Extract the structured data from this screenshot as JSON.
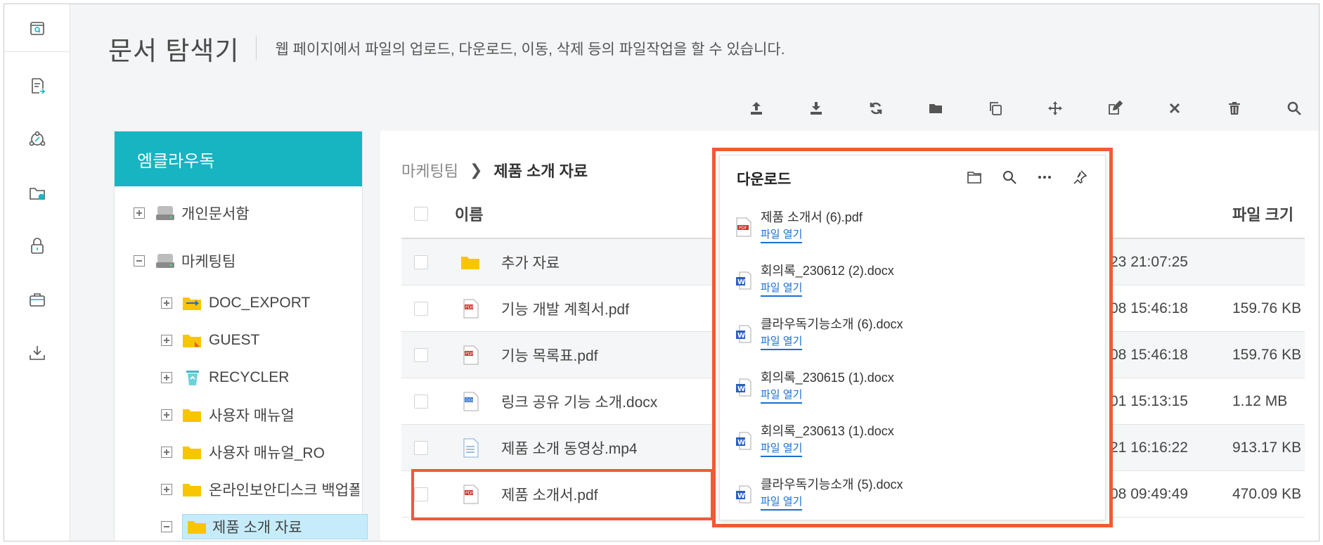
{
  "header": {
    "title": "문서 탐색기",
    "description": "웹 페이지에서 파일의 업로드, 다운로드, 이동, 삭제 등의 파일작업을 할 수 있습니다."
  },
  "rail": [
    {
      "name": "document-search-icon"
    },
    {
      "name": "document-export-icon"
    },
    {
      "name": "share-link-icon"
    },
    {
      "name": "folder-settings-icon"
    },
    {
      "name": "lock-icon"
    },
    {
      "name": "briefcase-icon"
    },
    {
      "name": "download-tray-icon"
    }
  ],
  "toolbar": [
    {
      "name": "upload-icon"
    },
    {
      "name": "download-icon"
    },
    {
      "name": "refresh-icon"
    },
    {
      "name": "new-folder-icon"
    },
    {
      "name": "copy-icon"
    },
    {
      "name": "move-icon"
    },
    {
      "name": "rename-icon"
    },
    {
      "name": "close-icon"
    },
    {
      "name": "trash-icon"
    },
    {
      "name": "search-icon"
    }
  ],
  "tree": {
    "header": "엠클라우독",
    "items": [
      {
        "label": "개인문서함",
        "toggle": "plus",
        "icon": "drive"
      },
      {
        "label": "마케팅팀",
        "toggle": "minus",
        "icon": "drive"
      },
      {
        "label": "DOC_EXPORT",
        "toggle": "plus",
        "icon": "folder-export"
      },
      {
        "label": "GUEST",
        "toggle": "plus",
        "icon": "folder-guest"
      },
      {
        "label": "RECYCLER",
        "toggle": "plus",
        "icon": "recycle"
      },
      {
        "label": "사용자 매뉴얼",
        "toggle": "plus",
        "icon": "folder"
      },
      {
        "label": "사용자 매뉴얼_RO",
        "toggle": "plus",
        "icon": "folder"
      },
      {
        "label": "온라인보안디스크 백업폴",
        "toggle": "plus",
        "icon": "folder"
      },
      {
        "label": "제품 소개 자료",
        "toggle": "minus",
        "icon": "folder",
        "selected": true
      }
    ]
  },
  "breadcrumb": {
    "parent": "마케팅팀",
    "current": "제품 소개 자료"
  },
  "table": {
    "col_name": "이름",
    "col_size": "파일 크기",
    "rows": [
      {
        "icon": "folder",
        "name": "추가 자료",
        "date": "23 21:07:25",
        "size": ""
      },
      {
        "icon": "pdf",
        "name": "기능 개발 계획서.pdf",
        "date": "08 15:46:18",
        "size": "159.76 KB"
      },
      {
        "icon": "pdf",
        "name": "기능 목록표.pdf",
        "date": "08 15:46:18",
        "size": "159.76 KB"
      },
      {
        "icon": "doc",
        "name": "링크 공유 기능 소개.docx",
        "date": "01 15:13:15",
        "size": "1.12 MB"
      },
      {
        "icon": "video",
        "name": "제품 소개 동영상.mp4",
        "date": "21 16:16:22",
        "size": "913.17 KB"
      },
      {
        "icon": "pdf",
        "name": "제품 소개서.pdf",
        "date": "08 09:49:49",
        "size": "470.09 KB"
      }
    ]
  },
  "downloads": {
    "title": "다운로드",
    "open_label": "파일 열기",
    "items": [
      {
        "type": "pdf",
        "name": "제품 소개서 (6).pdf"
      },
      {
        "type": "word",
        "name": "회의록_230612 (2).docx"
      },
      {
        "type": "word",
        "name": "클라우독기능소개 (6).docx"
      },
      {
        "type": "word",
        "name": "회의록_230615 (1).docx"
      },
      {
        "type": "word",
        "name": "회의록_230613 (1).docx"
      },
      {
        "type": "word",
        "name": "클라우독기능소개 (5).docx"
      }
    ]
  },
  "colors": {
    "accent": "#17b4c1",
    "highlight": "#f05a35",
    "link": "#1a6fd1",
    "folder": "#f7c600"
  }
}
